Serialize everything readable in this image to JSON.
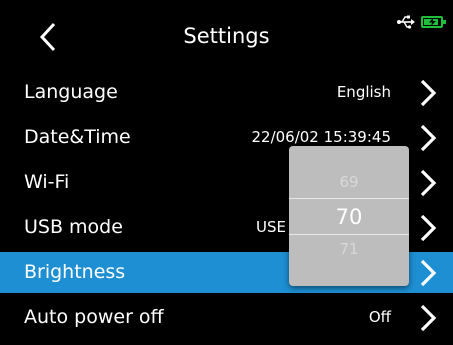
{
  "header": {
    "title": "Settings",
    "back_icon": "chevron-left-icon",
    "usb_icon": "usb-icon",
    "battery_icon": "battery-charging-icon",
    "battery_level": 0.85,
    "battery_color": "#1fbf3a"
  },
  "settings": {
    "accent_color": "#1e8fd2",
    "arrow_icon": "chevron-right-icon",
    "rows": [
      {
        "label": "Language",
        "value": "English"
      },
      {
        "label": "Date&Time",
        "value": "22/06/02 15:39:45"
      },
      {
        "label": "Wi-Fi",
        "value": ""
      },
      {
        "label": "USB mode",
        "value": "USE"
      },
      {
        "label": "Brightness",
        "value": ""
      },
      {
        "label": "Auto power off",
        "value": "Off"
      }
    ]
  },
  "brightness_picker": {
    "prev": "69",
    "current": "70",
    "next": "71"
  }
}
